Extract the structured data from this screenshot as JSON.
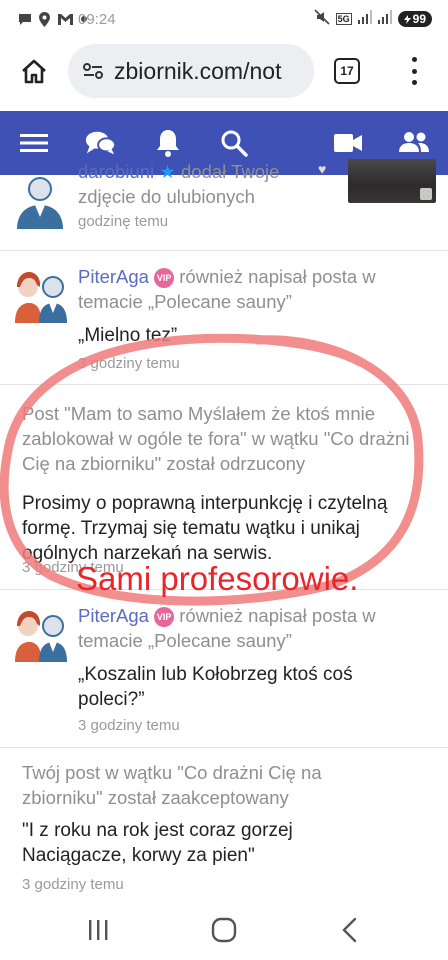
{
  "status_bar": {
    "time": "09:24",
    "network": "5G",
    "battery": "99"
  },
  "browser": {
    "url": "zbiornik.com/not",
    "tab_count": "17"
  },
  "nav": {
    "icons": [
      "menu-icon",
      "chat-icon",
      "bell-icon",
      "search-icon",
      "video-icon",
      "people-icon"
    ],
    "active": "people-icon",
    "colors": {
      "bar": "#3f51b5",
      "active_indicator": "#4caf50"
    }
  },
  "feed": {
    "item0": {
      "user": "darobiuni",
      "action": "dodał Twoje zdjęcie do ulubionych",
      "time": "godzinę temu"
    },
    "item1": {
      "user": "PiterAga",
      "badge": "VIP",
      "action": "również napisał posta w temacie „Polecane sauny”",
      "quote": "„Mielno tez”",
      "time": "3 godziny temu"
    },
    "item2": {
      "text": "Post \"Mam to samo Myślałem że ktoś mnie zablokował w ogóle te fora\" w wątku \"Co drażni Cię na zbiorniku\" został odrzucony",
      "reason": "Prosimy o poprawną interpunkcję i czytelną formę. Trzymaj się tematu wątku i unikaj ogólnych narzekań na serwis.",
      "time": "3 godziny temu"
    },
    "item3": {
      "user": "PiterAga",
      "badge": "VIP",
      "action": "również napisał posta w temacie „Polecane sauny”",
      "quote": "„Koszalin lub Kołobrzeg ktoś coś poleci?”",
      "time": "3 godziny temu"
    },
    "item4": {
      "text": "Twój post w wątku \"Co drażni Cię na zbiorniku\" został zaakceptowany",
      "quote": "\"I z roku na rok jest coraz gorzej Naciągacze, korwy za pien\"",
      "time": "3 godziny temu"
    }
  },
  "annotation": {
    "text": "Sami profesorowie.",
    "color": "#e8262a"
  }
}
